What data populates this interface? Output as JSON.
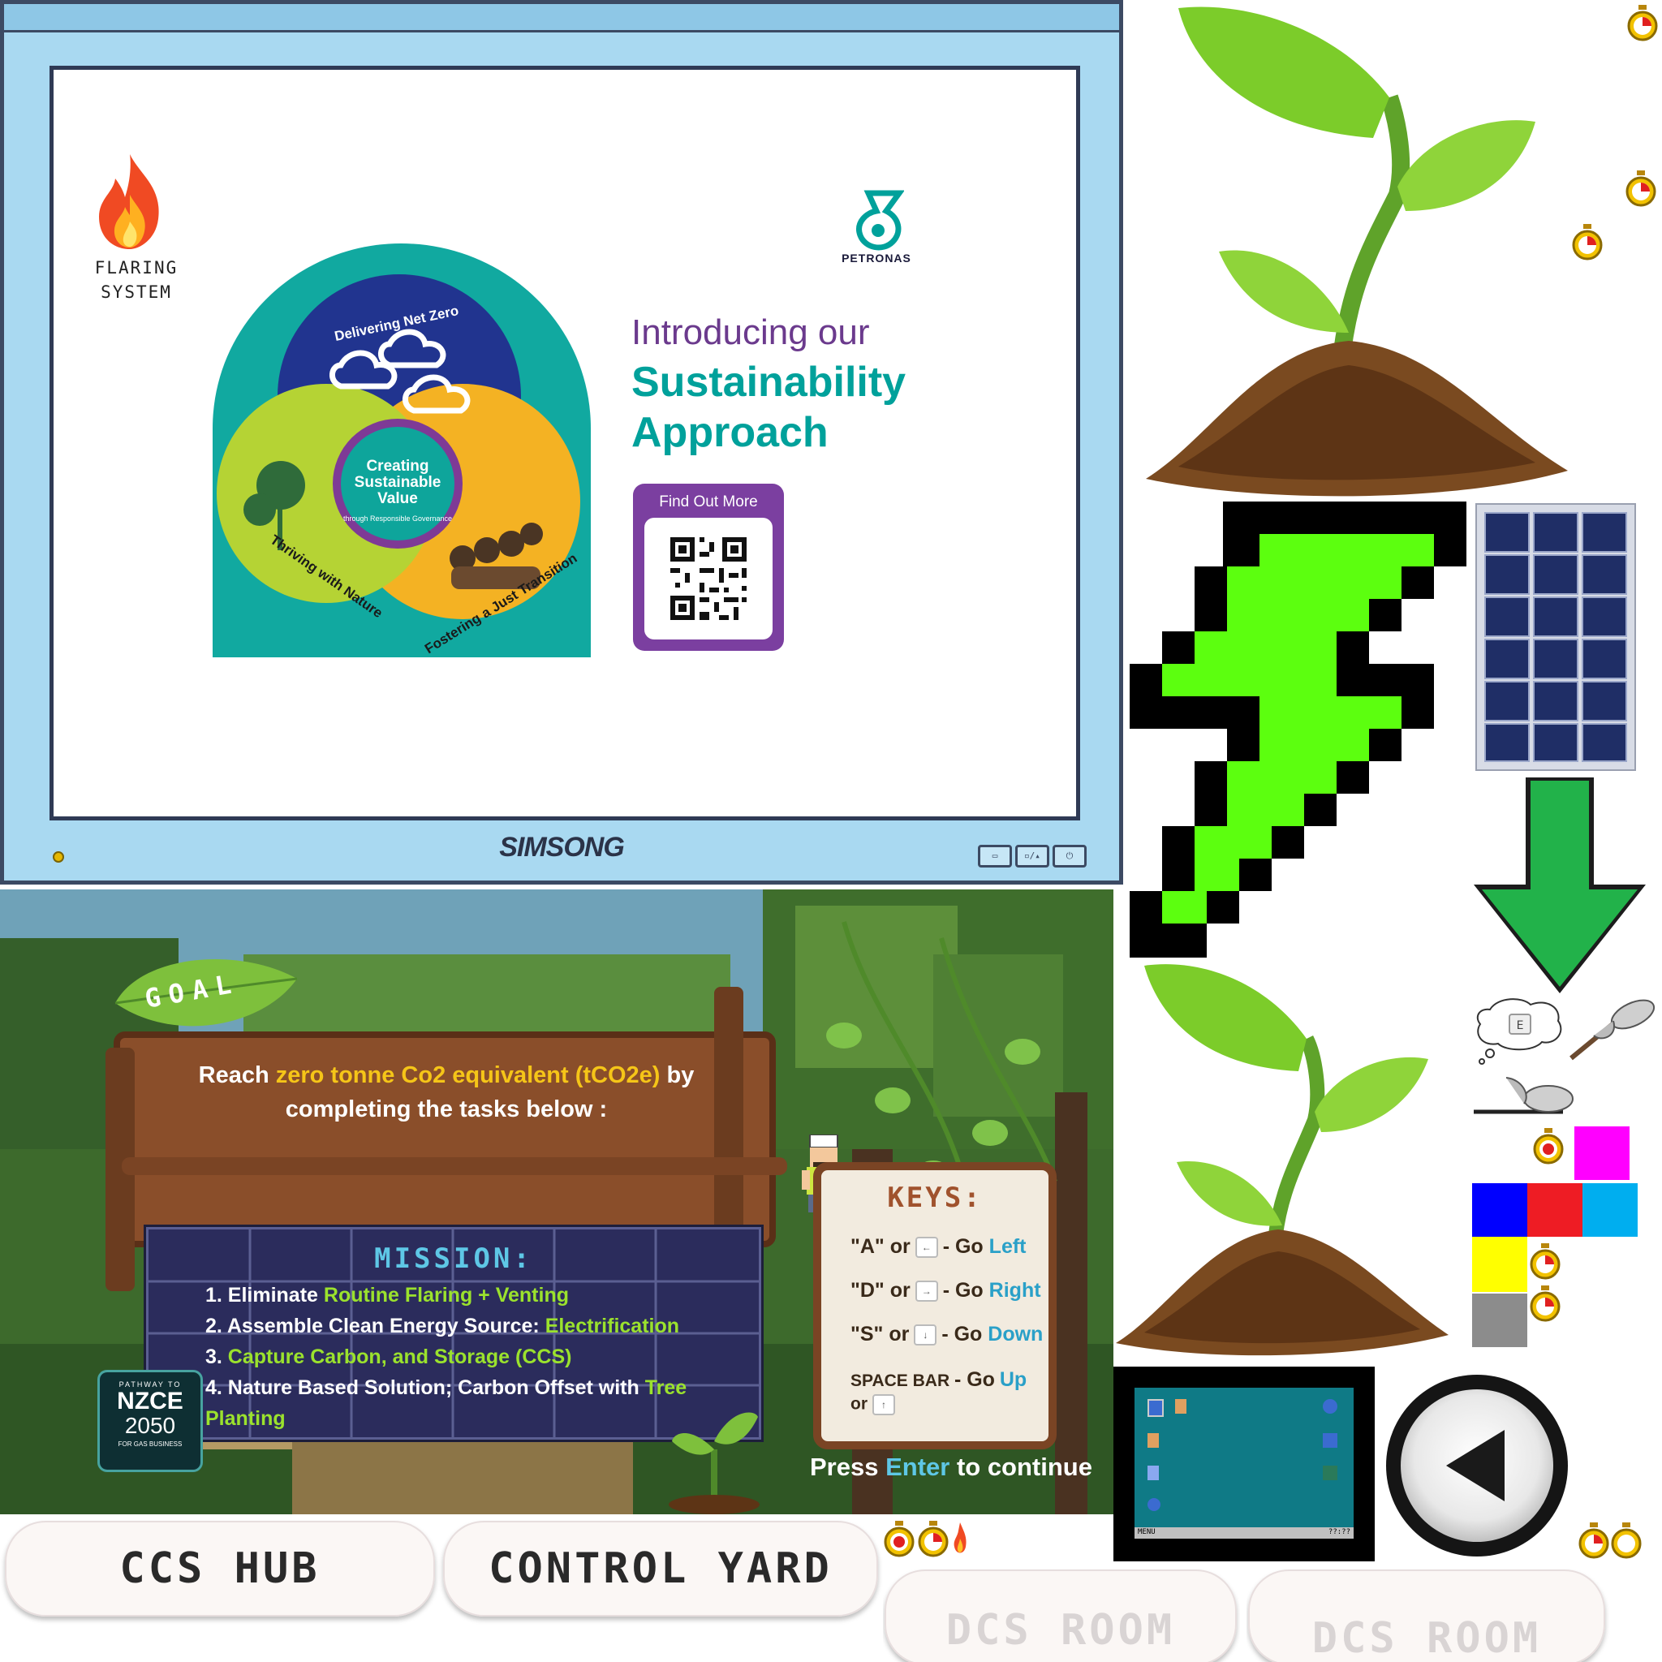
{
  "monitor": {
    "brand": "SIMSONG",
    "button_labels": [
      "▭",
      "▫/▴",
      "⏻"
    ]
  },
  "slide": {
    "flare_label_line1": "FLARING",
    "flare_label_line2": "SYSTEM",
    "company": "PETRONAS",
    "heading_line1": "Introducing our",
    "heading_line2": "Sustainability",
    "heading_line3": "Approach",
    "qr_title": "Find Out More",
    "diagram": {
      "top": "Delivering Net Zero",
      "center_line1": "Creating",
      "center_line2": "Sustainable",
      "center_line3": "Value",
      "center_sub": "through Responsible Governance",
      "left": "Thriving with Nature",
      "right": "Fostering a Just Transition"
    }
  },
  "goal": {
    "tag": "GOAL",
    "line1_pre": "Reach ",
    "line1_highlight": "zero tonne Co2 equivalent (tCO2e)",
    "line1_post": " by",
    "line2": "completing the tasks below :"
  },
  "mission": {
    "title": "MISSION:",
    "items": [
      {
        "pre": "1. Eliminate ",
        "hl": "Routine Flaring + Venting",
        "post": ""
      },
      {
        "pre": "2. Assemble Clean Energy Source: ",
        "hl": "Electrification",
        "post": ""
      },
      {
        "pre": "3. ",
        "hl": "Capture Carbon, and Storage (CCS)",
        "post": ""
      },
      {
        "pre": "4. Nature Based Solution; Carbon Offset with ",
        "hl": "Tree Planting",
        "post": ""
      }
    ]
  },
  "nzce": {
    "top": "PATHWAY TO",
    "mid": "NZCE",
    "year": "2050",
    "bottom": "FOR GAS BUSINESS"
  },
  "keys": {
    "title": "KEYS:",
    "rows": [
      {
        "key": "\"A\" or",
        "kb": "←",
        "action": "- Go",
        "dir": "Left"
      },
      {
        "key": "\"D\" or",
        "kb": "→",
        "action": "- Go",
        "dir": "Right"
      },
      {
        "key": "\"S\" or",
        "kb": "↓",
        "action": "- Go",
        "dir": "Down"
      },
      {
        "key": "SPACE BAR",
        "kb": "↑",
        "action": "- Go",
        "dir": "Up",
        "or": "or"
      }
    ],
    "continue_pre": "Press ",
    "continue_hl": "Enter",
    "continue_post": " to continue"
  },
  "buttons": {
    "ccs_hub": "CCS HUB",
    "control_yard": "CONTROL YARD",
    "dcs_room_1": "DCS ROOM",
    "dcs_room_2": "DCS ROOM"
  },
  "sprites": {
    "speech_key": "E",
    "desktop_menu": "MENU",
    "desktop_clock": "??:??"
  },
  "colors": {
    "accent_teal": "#00a19b",
    "accent_purple": "#7b3fa0",
    "lightning_green": "#5cff0f",
    "highlight_yellow": "#f5c518",
    "highlight_green": "#9be22d",
    "swatches": [
      "#ff00ff",
      "#0000ff",
      "#ee1c24",
      "#00aeef",
      "#ffff00",
      "#8c8c8c"
    ]
  }
}
